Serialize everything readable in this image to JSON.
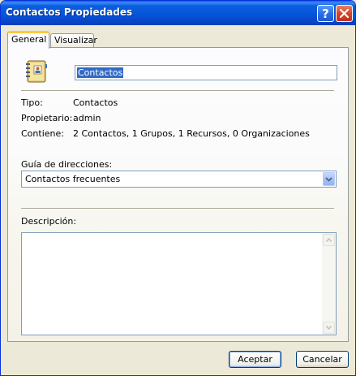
{
  "window": {
    "title": "Contactos Propiedades",
    "help_glyph": "?"
  },
  "tabs": [
    {
      "label": "General",
      "active": true
    },
    {
      "label": "Visualizar",
      "active": false
    }
  ],
  "general": {
    "icon": "address-book-icon",
    "name_value": "Contactos",
    "type_label": "Tipo:",
    "type_value": "Contactos",
    "owner_label": "Propietario:",
    "owner_value": "admin",
    "contains_label": "Contiene:",
    "contains_value": "2 Contactos, 1 Grupos, 1 Recursos, 0 Organizaciones",
    "address_guide_label": "Guía de direcciones:",
    "address_guide_value": "Contactos frecuentes",
    "description_label": "Descripción:",
    "description_value": ""
  },
  "buttons": {
    "ok": "Aceptar",
    "cancel": "Cancelar"
  },
  "colors": {
    "titlebar": "#0553d8",
    "selection": "#316ac5",
    "active_tab_accent": "#ffc83c"
  }
}
